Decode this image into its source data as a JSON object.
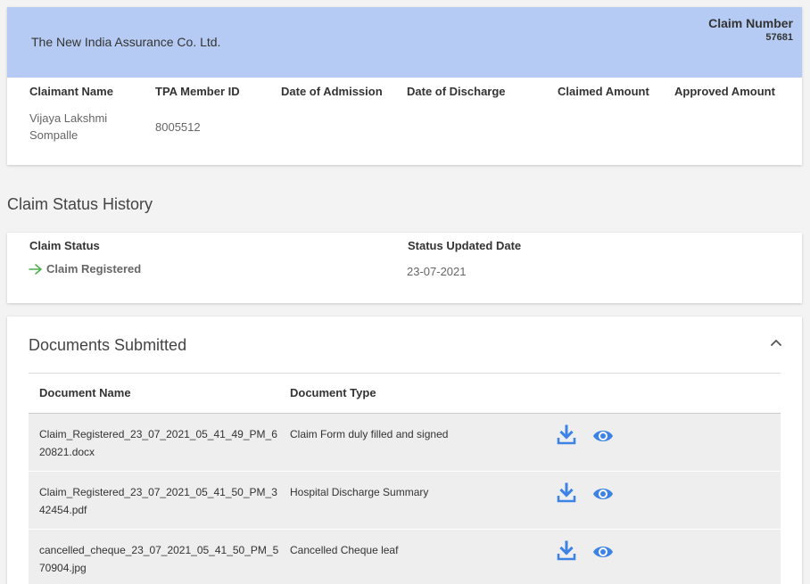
{
  "header": {
    "company": "The New India Assurance Co. Ltd.",
    "claim_number_label": "Claim Number",
    "claim_number_value": "57681"
  },
  "claimant": {
    "headers": [
      "Claimant Name",
      "TPA Member ID",
      "Date of Admission",
      "Date of Discharge",
      "Claimed Amount",
      "Approved Amount"
    ],
    "name": "Vijaya Lakshmi Sompalle",
    "tpa_member_id": "8005512",
    "date_of_admission": "",
    "date_of_discharge": "",
    "claimed_amount": "",
    "approved_amount": ""
  },
  "status_history": {
    "title": "Claim Status History",
    "headers": [
      "Claim Status",
      "Status Updated Date"
    ],
    "rows": [
      {
        "status": "Claim Registered",
        "date": "23-07-2021"
      }
    ],
    "colors": {
      "arrow": "#4caf50"
    }
  },
  "documents": {
    "title": "Documents Submitted",
    "headers": [
      "Document Name",
      "Document Type"
    ],
    "rows": [
      {
        "name": "Claim_Registered_23_07_2021_05_41_49_PM_620821.docx",
        "type": "Claim Form duly filled and signed",
        "actions": [
          "download-icon",
          "eye-icon"
        ]
      },
      {
        "name": "Claim_Registered_23_07_2021_05_41_50_PM_342454.pdf",
        "type": "Hospital Discharge Summary",
        "actions": [
          "download-icon",
          "eye-icon"
        ]
      },
      {
        "name": "cancelled_cheque_23_07_2021_05_41_50_PM_570904.jpg",
        "type": "Cancelled Cheque leaf",
        "actions": [
          "download-icon",
          "eye-icon"
        ]
      }
    ],
    "colors": {
      "action_icons": "#3d83e6",
      "header_band": "#b6cbf3"
    }
  }
}
